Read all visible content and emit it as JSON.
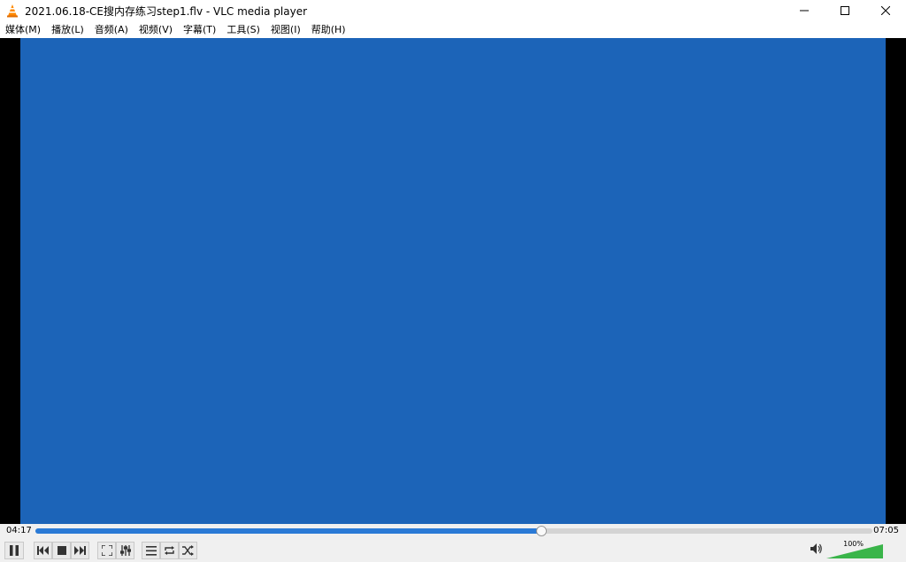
{
  "window": {
    "title": "2021.06.18-CE搜内存练习step1.flv - VLC media player",
    "icon": "vlc-cone-icon",
    "controls": [
      "minimize-icon",
      "maximize-icon",
      "close-icon"
    ]
  },
  "menu": {
    "items": [
      {
        "label": "媒体(M)"
      },
      {
        "label": "播放(L)"
      },
      {
        "label": "音频(A)"
      },
      {
        "label": "视频(V)"
      },
      {
        "label": "字幕(T)"
      },
      {
        "label": "工具(S)"
      },
      {
        "label": "视图(I)"
      },
      {
        "label": "帮助(H)"
      }
    ]
  },
  "video": {
    "content": "screen recording of a Windows 7 desktop"
  },
  "playback": {
    "elapsed": "04:17",
    "total": "07:05",
    "progress_fraction": 0.6047
  },
  "buttons": [
    {
      "name": "pause-button",
      "icon": "pause-icon"
    },
    {
      "name": "previous-button",
      "icon": "previous-icon"
    },
    {
      "name": "stop-button",
      "icon": "stop-icon"
    },
    {
      "name": "next-button",
      "icon": "next-icon"
    },
    {
      "name": "fullscreen-button",
      "icon": "fullscreen-icon"
    },
    {
      "name": "extended-settings-button",
      "icon": "equalizer-icon"
    },
    {
      "name": "playlist-button",
      "icon": "playlist-icon"
    },
    {
      "name": "loop-button",
      "icon": "loop-icon"
    },
    {
      "name": "random-button",
      "icon": "shuffle-icon"
    }
  ],
  "volume": {
    "label": "100%",
    "level_fraction": 1.0,
    "icon": "speaker-icon"
  },
  "colors": {
    "accent": "#2a7ad6",
    "video_bg": "#000000",
    "desktop": "#1c64b8"
  }
}
